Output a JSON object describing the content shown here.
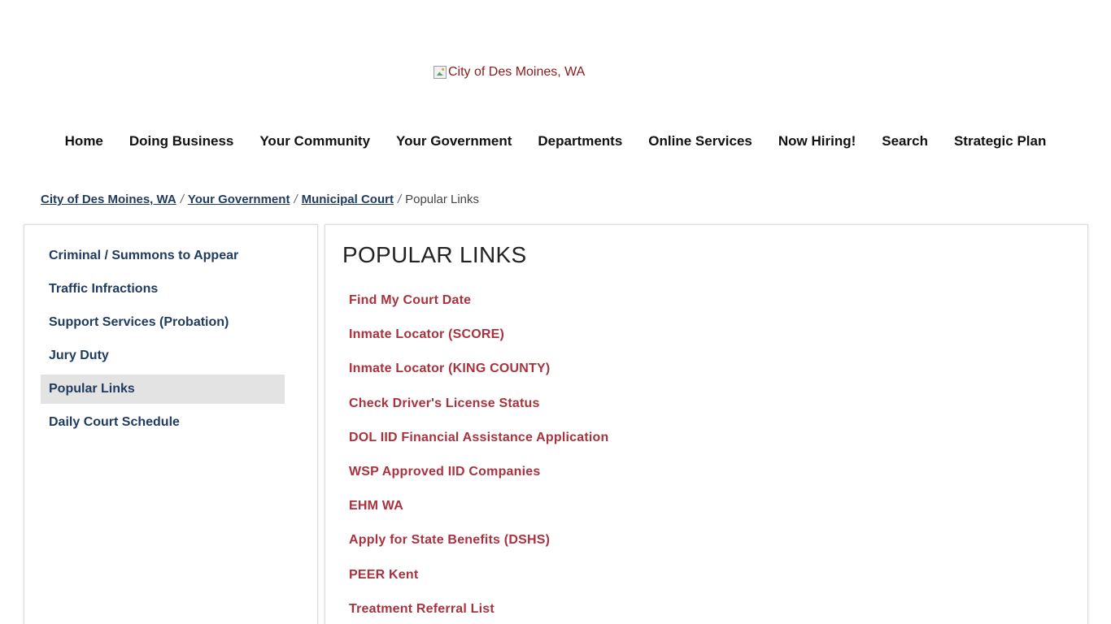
{
  "header": {
    "logo_alt": "City of Des Moines, WA"
  },
  "nav": {
    "items": [
      "Home",
      "Doing Business",
      "Your Community",
      "Your Government",
      "Departments",
      "Online Services",
      "Now Hiring!",
      "Search",
      "Strategic Plan"
    ]
  },
  "breadcrumb": {
    "links": [
      "City of Des Moines, WA",
      "Your Government",
      "Municipal Court"
    ],
    "separator": "/",
    "current": "Popular Links"
  },
  "sidebar": {
    "items": [
      "Criminal / Summons to Appear",
      "Traffic Infractions",
      "Support Services (Probation)",
      "Jury Duty",
      "Popular Links",
      "Daily Court Schedule"
    ],
    "active": "Popular Links"
  },
  "main": {
    "title": "POPULAR LINKS",
    "links": [
      "Find My Court Date",
      "Inmate Locator (SCORE)",
      "Inmate Locator (KING COUNTY)",
      "Check Driver's License Status",
      "DOL IID Financial Assistance Application",
      "WSP Approved IID Companies",
      "EHM WA",
      "Apply for State Benefits (DSHS)",
      "PEER Kent",
      "Treatment Referral List"
    ]
  },
  "colors": {
    "nav_link": "#1f3a5f",
    "content_link": "#a8323e",
    "logo_text": "#8a1b1b",
    "active_bg": "#e3e3e3"
  }
}
